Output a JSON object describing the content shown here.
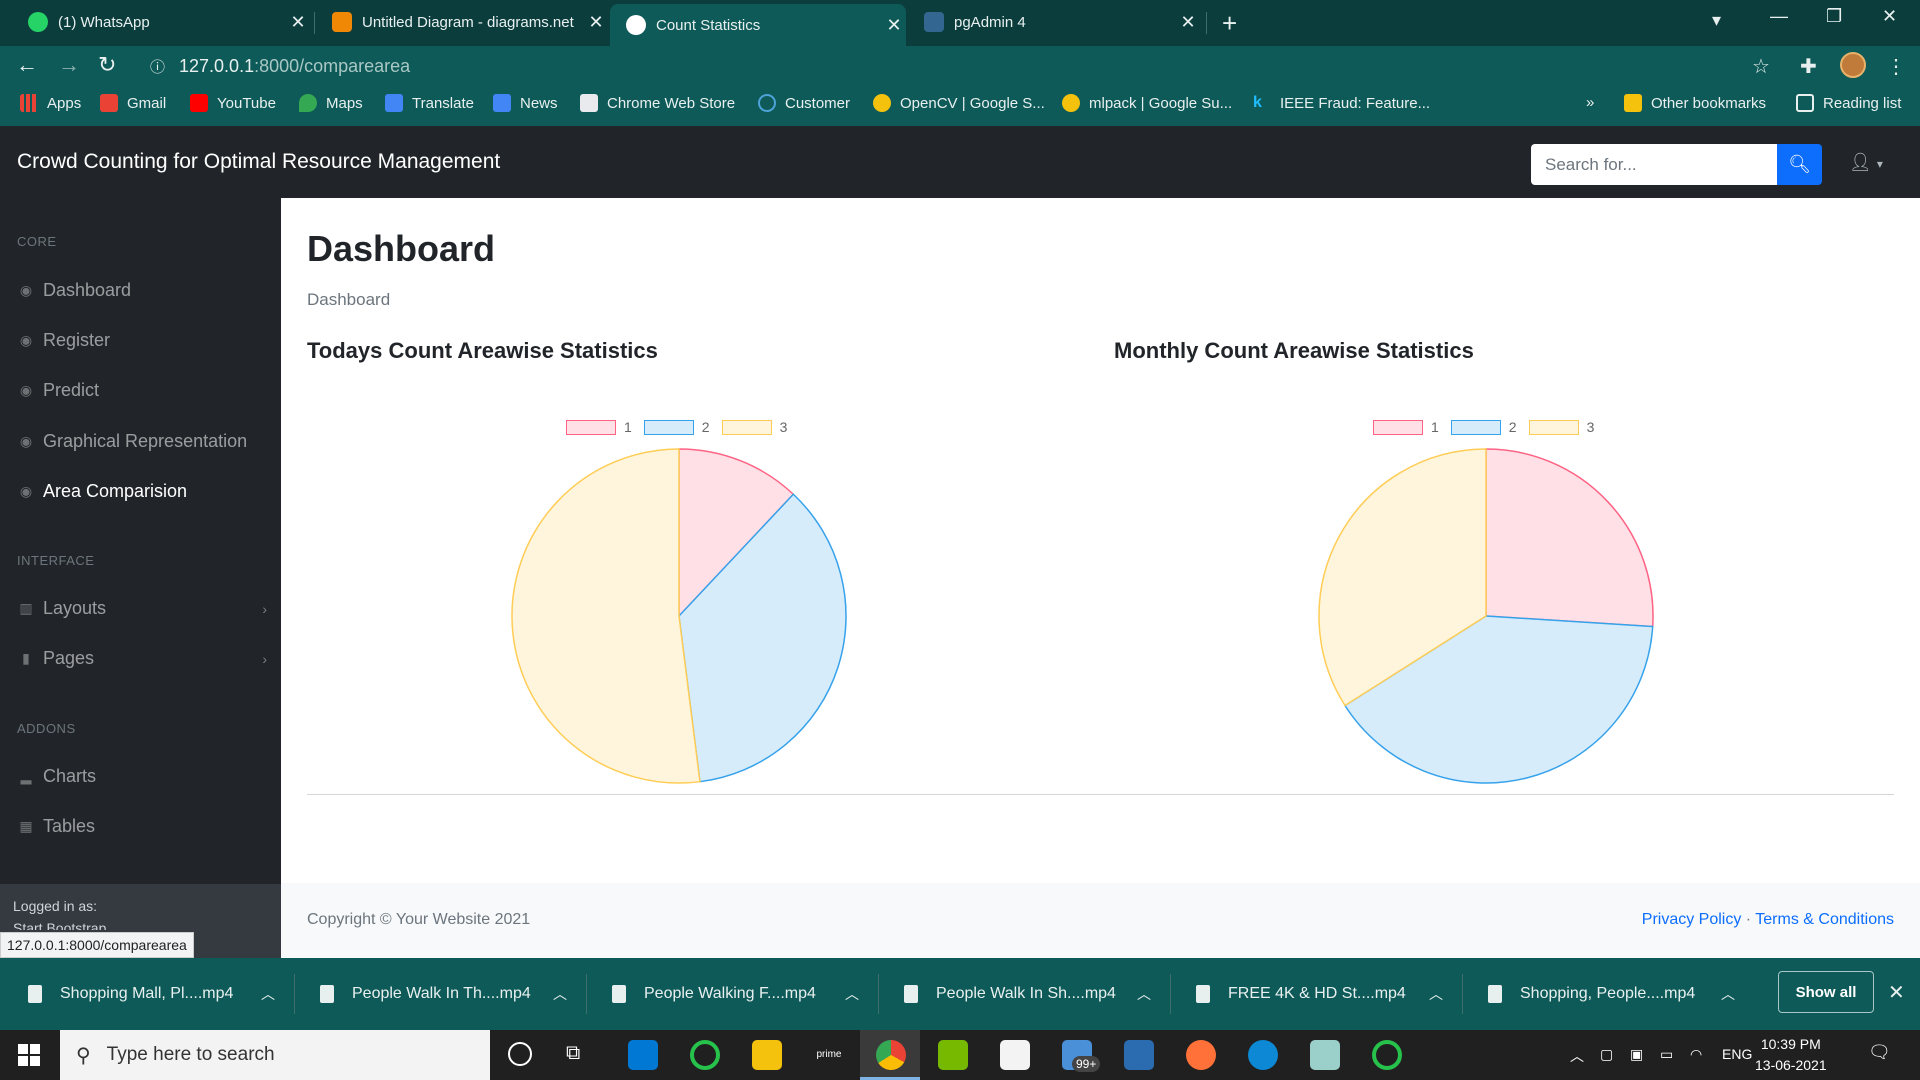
{
  "browser": {
    "tabs": [
      {
        "title": "(1) WhatsApp",
        "icon": "whatsapp-icon",
        "color": "#25d366"
      },
      {
        "title": "Untitled Diagram - diagrams.net",
        "icon": "drawio-icon",
        "color": "#f08705"
      },
      {
        "title": "Count Statistics",
        "icon": "globe-icon",
        "color": "#ffffff"
      },
      {
        "title": "pgAdmin 4",
        "icon": "pgadmin-icon",
        "color": "#336791"
      }
    ],
    "url_host": "127.0.0.1",
    "url_path": ":8000/comparearea",
    "bookmarks": [
      {
        "label": "Apps"
      },
      {
        "label": "Gmail"
      },
      {
        "label": "YouTube"
      },
      {
        "label": "Maps"
      },
      {
        "label": "Translate"
      },
      {
        "label": "News"
      },
      {
        "label": "Chrome Web Store"
      },
      {
        "label": "Customer"
      },
      {
        "label": "OpenCV | Google S..."
      },
      {
        "label": "mlpack | Google Su..."
      },
      {
        "label": "IEEE Fraud: Feature..."
      }
    ],
    "bookmarks_overflow": "»",
    "other_bookmarks": "Other bookmarks",
    "reading_list": "Reading list"
  },
  "app": {
    "brand": "Crowd Counting for Optimal Resource Management",
    "search_placeholder": "Search for...",
    "sidebar": {
      "core_heading": "CORE",
      "core_items": [
        {
          "label": "Dashboard"
        },
        {
          "label": "Register"
        },
        {
          "label": "Predict"
        },
        {
          "label": "Graphical Representation"
        },
        {
          "label": "Area Comparision"
        }
      ],
      "interface_heading": "INTERFACE",
      "interface_items": [
        {
          "label": "Layouts"
        },
        {
          "label": "Pages"
        }
      ],
      "addons_heading": "ADDONS",
      "addons_items": [
        {
          "label": "Charts"
        },
        {
          "label": "Tables"
        }
      ],
      "logged_in_label": "Logged in as:",
      "logged_in_user": "Start Bootstrap"
    },
    "status_url": "127.0.0.1:8000/comparearea",
    "page_title": "Dashboard",
    "breadcrumb": "Dashboard",
    "footer": {
      "copyright": "Copyright © Your Website 2021",
      "privacy": "Privacy Policy",
      "separator": "·",
      "terms": "Terms & Conditions"
    }
  },
  "chart_data": [
    {
      "type": "pie",
      "title": "Todays Count Areawise Statistics",
      "categories": [
        "1",
        "2",
        "3"
      ],
      "values": [
        12,
        36,
        52
      ],
      "colors": {
        "fill": [
          "#ffe0e6",
          "#d7ecfb",
          "#fff5dd"
        ],
        "stroke": [
          "#ff6384",
          "#36a2eb",
          "#ffcd56"
        ]
      },
      "legend": "top"
    },
    {
      "type": "pie",
      "title": "Monthly Count Areawise Statistics",
      "categories": [
        "1",
        "2",
        "3"
      ],
      "values": [
        26,
        40,
        34
      ],
      "colors": {
        "fill": [
          "#ffe0e6",
          "#d7ecfb",
          "#fff5dd"
        ],
        "stroke": [
          "#ff6384",
          "#36a2eb",
          "#ffcd56"
        ]
      },
      "legend": "top"
    }
  ],
  "downloads": {
    "items": [
      {
        "name": "Shopping Mall, Pl....mp4"
      },
      {
        "name": "People Walk In Th....mp4"
      },
      {
        "name": "People Walking F....mp4"
      },
      {
        "name": "People Walk In Sh....mp4"
      },
      {
        "name": "FREE 4K & HD St....mp4"
      },
      {
        "name": "Shopping, People....mp4"
      }
    ],
    "show_all": "Show all"
  },
  "taskbar": {
    "search_placeholder": "Type here to search",
    "language": "ENG",
    "time": "10:39 PM",
    "date": "13-06-2021",
    "mail_badge": "99+"
  }
}
